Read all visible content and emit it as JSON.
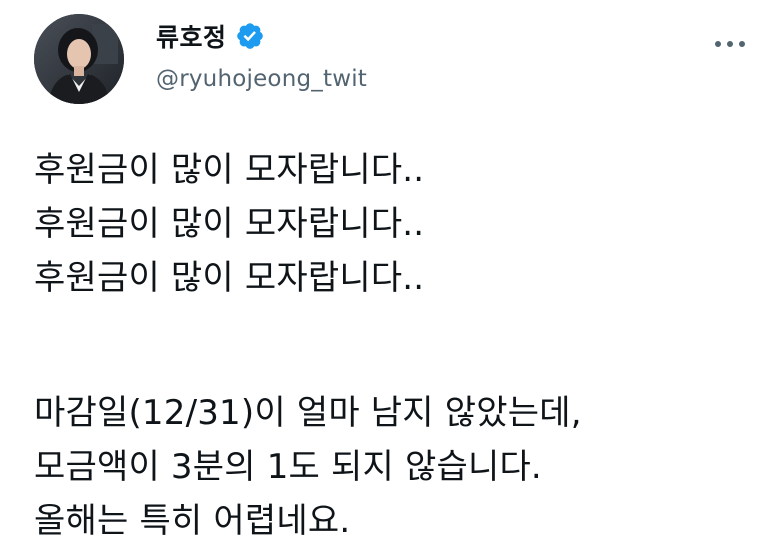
{
  "tweet": {
    "display_name": "류호정",
    "handle": "@ryuhojeong_twit",
    "verified_icon": "verified-badge-icon",
    "more_icon": "more-dots-icon",
    "accent_color": "#1d9bf0",
    "paragraphs": [
      {
        "lines": [
          "후원금이 많이 모자랍니다..",
          "후원금이 많이 모자랍니다..",
          "후원금이 많이 모자랍니다.."
        ]
      },
      {
        "lines": [
          "마감일(12/31)이 얼마 남지 않았는데,",
          "모금액이 3분의 1도 되지 않습니다.",
          "올해는 특히 어렵네요."
        ]
      }
    ]
  }
}
